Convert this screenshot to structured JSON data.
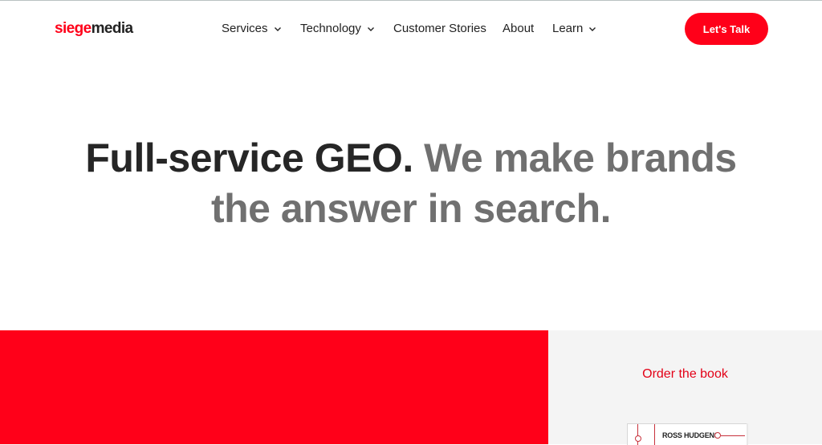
{
  "header": {
    "logo": {
      "part1": "siege",
      "part2": "media"
    },
    "nav": [
      {
        "label": "Services",
        "has_dropdown": true
      },
      {
        "label": "Technology",
        "has_dropdown": true
      },
      {
        "label": "Customer Stories",
        "has_dropdown": false
      },
      {
        "label": "About",
        "has_dropdown": false
      },
      {
        "label": "Learn",
        "has_dropdown": true
      }
    ],
    "cta_label": "Let's Talk"
  },
  "hero": {
    "headline_dark": "Full-service GEO.",
    "headline_gray_1": "We make brands",
    "headline_gray_2": "the answer in search."
  },
  "book_promo": {
    "label": "Order the book",
    "author": "ROSS HUDGENS"
  },
  "colors": {
    "brand_red": "#ff0019",
    "text_dark": "#262626",
    "text_gray": "#707070",
    "panel_gray": "#f4f4f4"
  },
  "icons": [
    "chevron-down-icon"
  ]
}
